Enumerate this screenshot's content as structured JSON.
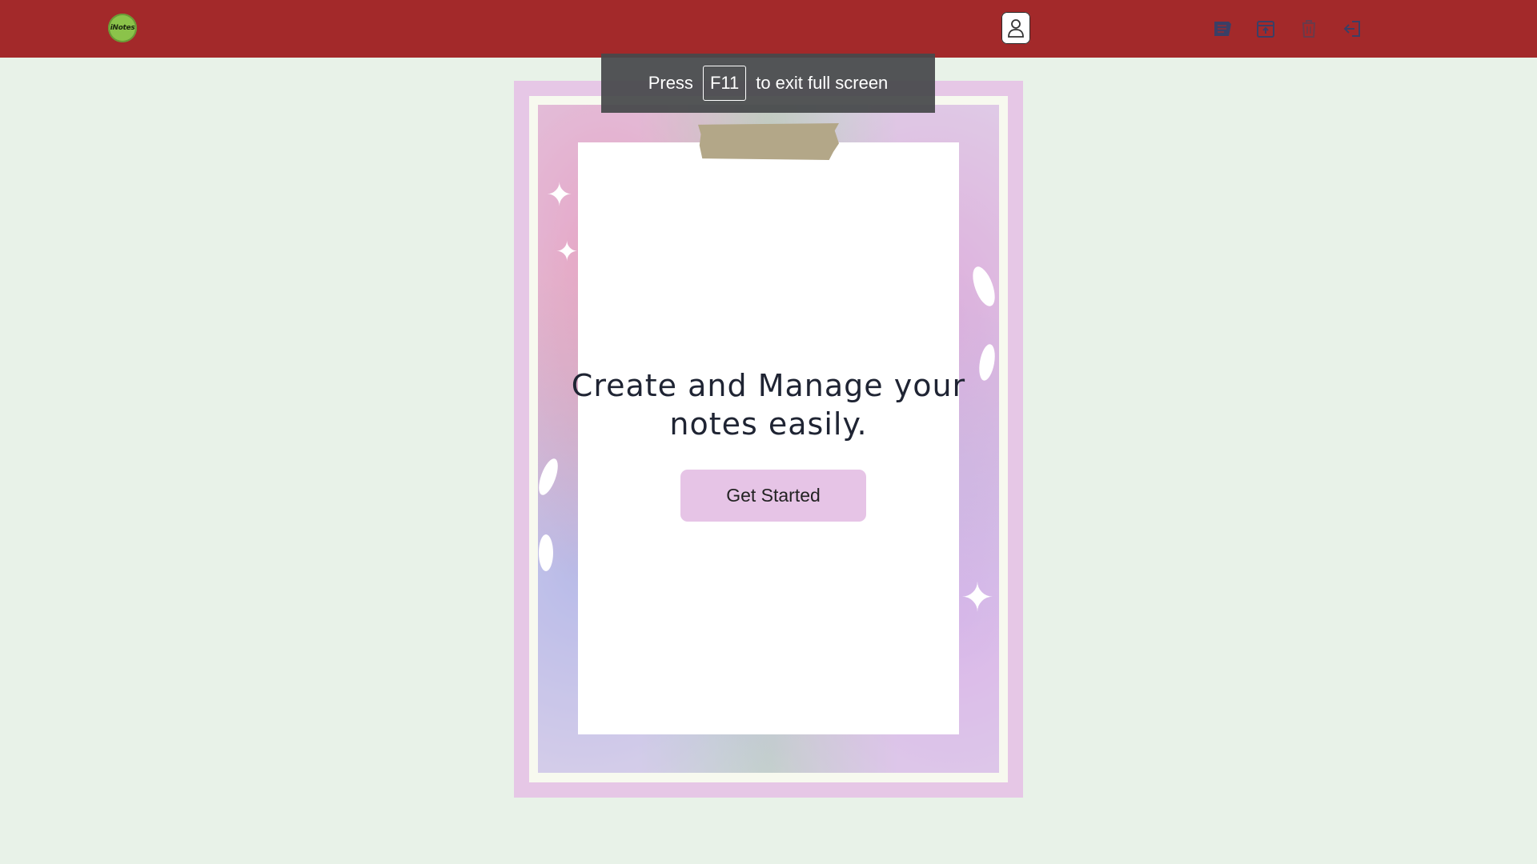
{
  "app": {
    "logo_text": "iNotes"
  },
  "navbar": {
    "color": "#a3292a",
    "icons": [
      {
        "name": "profile-icon"
      },
      {
        "name": "notes-icon"
      },
      {
        "name": "archive-icon"
      },
      {
        "name": "trash-icon"
      },
      {
        "name": "logout-icon"
      }
    ]
  },
  "fullscreen_toast": {
    "prefix": "Press",
    "key": "F11",
    "suffix": "to exit full screen"
  },
  "hero": {
    "headline_line1": "Create and Manage your",
    "headline_line2": "notes easily.",
    "cta_label": "Get Started",
    "cta_color": "#e6c4e6",
    "frame_color": "#e6c7e6"
  },
  "page": {
    "background": "#e8f2e8"
  }
}
